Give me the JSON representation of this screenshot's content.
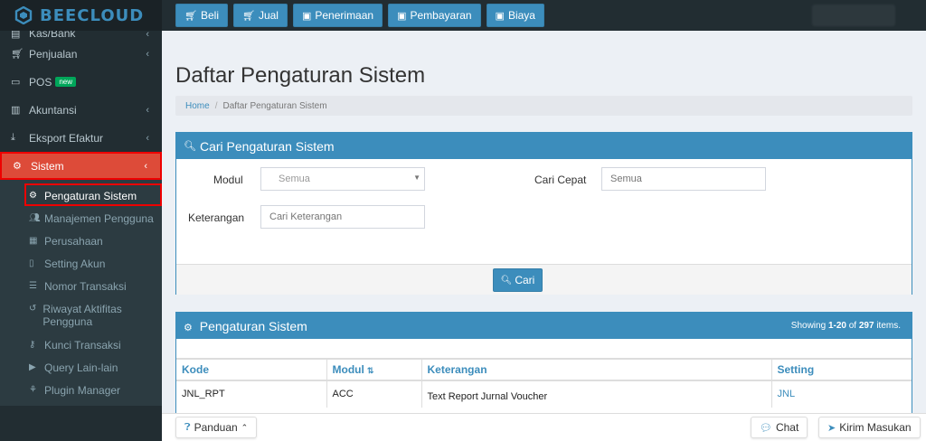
{
  "app": {
    "logo_text": "BEECLOUD"
  },
  "colors": {
    "accent": "#3c8dbc",
    "sidebar_bg": "#222d32",
    "active": "#dd4b39",
    "highlight_border": "#ee0000"
  },
  "topnav": [
    {
      "label": "Beli",
      "icon": "cart-icon"
    },
    {
      "label": "Jual",
      "icon": "cart-icon"
    },
    {
      "label": "Penerimaan",
      "icon": "money-icon"
    },
    {
      "label": "Pembayaran",
      "icon": "money-icon"
    },
    {
      "label": "Biaya",
      "icon": "money-icon"
    }
  ],
  "sidebar": {
    "items": [
      {
        "label": "Kas/Bank",
        "icon": "cash-icon"
      },
      {
        "label": "Penjualan",
        "icon": "cart-icon"
      },
      {
        "label": "POS",
        "icon": "monitor-icon",
        "badge": "new"
      },
      {
        "label": "Akuntansi",
        "icon": "chart-icon"
      },
      {
        "label": "Eksport Efaktur",
        "icon": "export-icon"
      },
      {
        "label": "Sistem",
        "icon": "gears-icon"
      }
    ],
    "submenu": [
      {
        "label": "Pengaturan Sistem",
        "icon": "gear-icon"
      },
      {
        "label": "Manajemen Pengguna",
        "icon": "users-icon"
      },
      {
        "label": "Perusahaan",
        "icon": "building-icon"
      },
      {
        "label": "Setting Akun",
        "icon": "file-icon"
      },
      {
        "label": "Nomor Transaksi",
        "icon": "list-icon"
      },
      {
        "label": "Riwayat Aktifitas Pengguna",
        "icon": "history-icon"
      },
      {
        "label": "Kunci Transaksi",
        "icon": "key-icon"
      },
      {
        "label": "Query Lain-lain",
        "icon": "play-icon"
      },
      {
        "label": "Plugin Manager",
        "icon": "plugin-icon"
      }
    ]
  },
  "page": {
    "title": "Daftar Pengaturan Sistem",
    "breadcrumb": {
      "home": "Home",
      "sep": "/",
      "current": "Daftar Pengaturan Sistem"
    }
  },
  "search": {
    "title": "Cari Pengaturan Sistem",
    "modul_label": "Modul",
    "modul_value": "Semua",
    "cari_cepat_label": "Cari Cepat",
    "cari_cepat_placeholder": "Semua",
    "keterangan_label": "Keterangan",
    "keterangan_placeholder": "Cari Keterangan",
    "button": "Cari"
  },
  "list": {
    "title": "Pengaturan Sistem",
    "showing_prefix": "Showing ",
    "showing_range": "1-20",
    "showing_of": " of ",
    "showing_total": "297",
    "showing_suffix": " items.",
    "columns": [
      "Kode",
      "Modul",
      "Keterangan",
      "Setting"
    ],
    "rows": [
      {
        "kode": "JNL_RPT",
        "modul": "ACC",
        "keterangan": "Text Report Jurnal Voucher",
        "setting": "JNL"
      }
    ]
  },
  "bottom": {
    "panduan": "Panduan",
    "chat": "Chat",
    "kirim": "Kirim Masukan"
  }
}
